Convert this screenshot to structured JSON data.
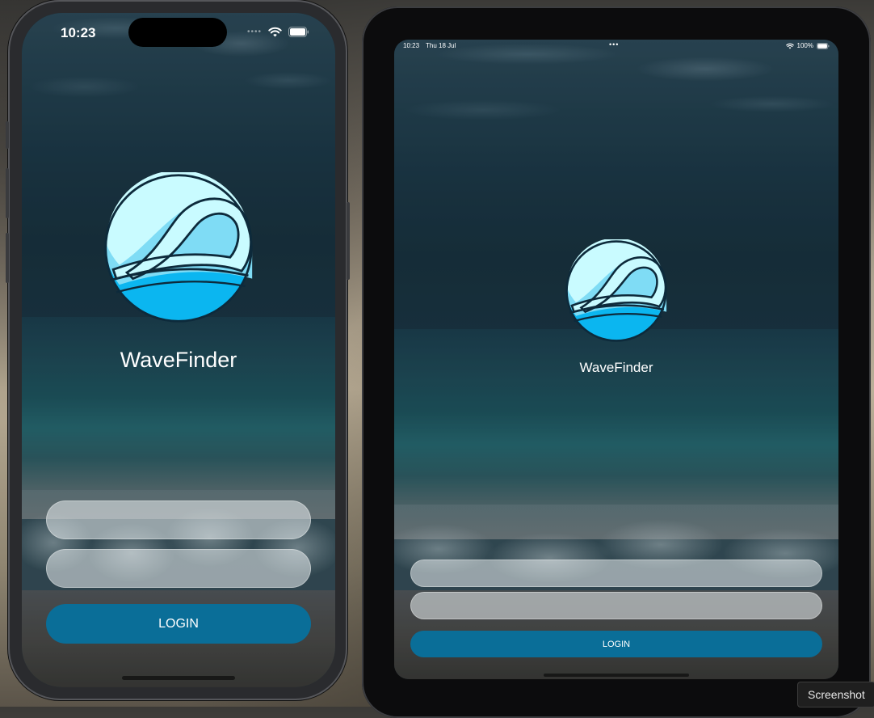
{
  "iphone": {
    "status_time": "10:23",
    "app_name": "WaveFinder",
    "username_field": {
      "value": "",
      "placeholder": ""
    },
    "password_field": {
      "value": "",
      "placeholder": ""
    },
    "login_label": "LOGIN"
  },
  "ipad": {
    "status_time": "10:23",
    "status_date": "Thu 18 Jul",
    "battery_percent": "100%",
    "app_name": "WaveFinder",
    "username_field": {
      "value": "",
      "placeholder": ""
    },
    "password_field": {
      "value": "",
      "placeholder": ""
    },
    "login_label": "LOGIN"
  },
  "tooltip": {
    "label": "Screenshot"
  },
  "colors": {
    "login_button": "#0a6e98",
    "logo_light": "#c9fbff",
    "logo_mid": "#7fdcf5",
    "logo_dark": "#0bb6f0",
    "logo_outline": "#0d2a3b"
  },
  "icons": [
    "wifi-icon",
    "battery-icon",
    "cellular-dots-icon",
    "multitask-dots-icon",
    "wave-logo-icon"
  ]
}
